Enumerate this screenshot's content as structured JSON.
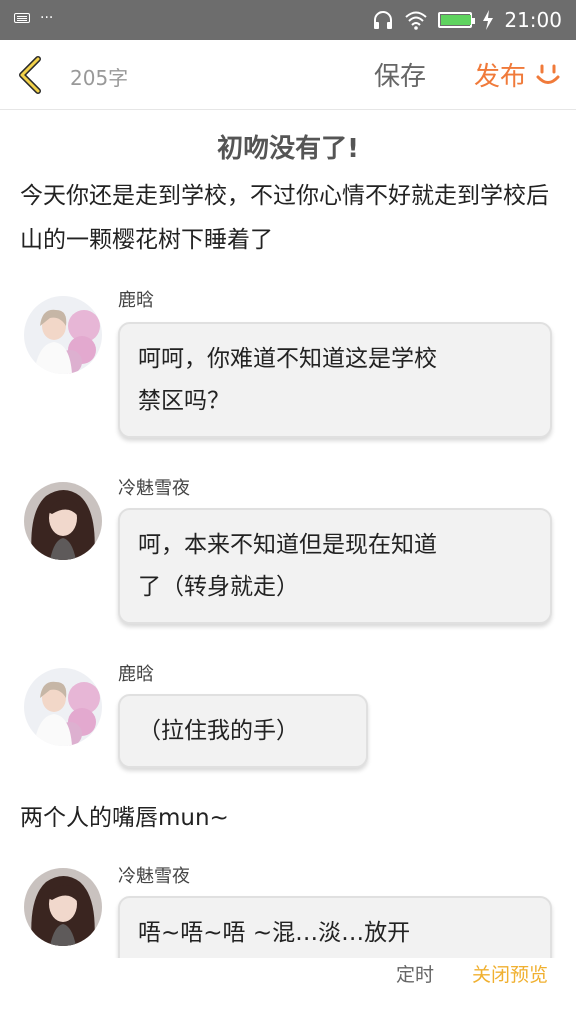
{
  "status_bar": {
    "left_icons": [
      "keyboard-icon",
      "more-dots-icon"
    ],
    "more": "···",
    "time": "21:00",
    "right_icons": [
      "headphones-icon",
      "wifi-icon",
      "battery-icon",
      "charging-icon"
    ],
    "battery_level": 1.0
  },
  "toolbar": {
    "word_count": "205字",
    "save_label": "保存",
    "publish_label": "发布",
    "accent_color": "#f07a3a"
  },
  "story": {
    "title": "初吻没有了!",
    "narration_1": "今天你还是走到学校，不过你心情不好就走到学校后山的一颗樱花树下睡着了",
    "narration_2": "两个人的嘴唇mun~"
  },
  "messages": [
    {
      "speaker": "鹿晗",
      "line1": "呵呵，你难道不知道这是学校",
      "line2": "禁区吗？"
    },
    {
      "speaker": "冷魅雪夜",
      "line1": "呵，本来不知道但是现在知道",
      "line2": "了（转身就走）"
    },
    {
      "speaker": "鹿晗",
      "line1": "（拉住我的手）"
    },
    {
      "speaker": "冷魅雪夜",
      "line1": "唔~唔~唔 ~混…淡…放开"
    }
  ],
  "bottom": {
    "timer_label": "定时",
    "close_preview_label": "关闭预览"
  }
}
